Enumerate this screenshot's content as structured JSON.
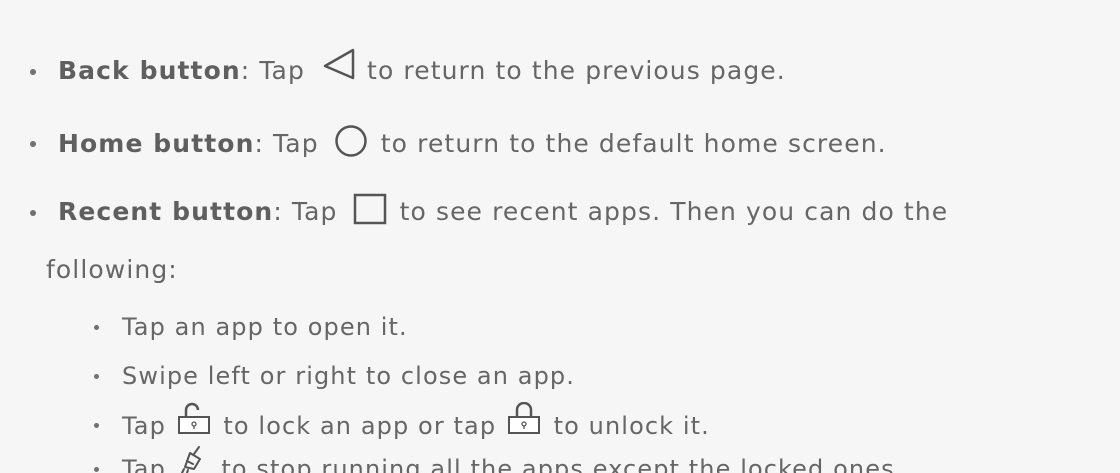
{
  "items": [
    {
      "term": "Back button",
      "colon": ":",
      "before": " Tap ",
      "icon": "back-triangle-icon",
      "after": " to return to the previous page."
    },
    {
      "term": "Home button",
      "colon": ":",
      "before": " Tap ",
      "icon": "home-circle-icon",
      "after": " to return to the default home screen."
    },
    {
      "term": "Recent button",
      "colon": ":",
      "before": " Tap ",
      "icon": "recent-square-icon",
      "after": " to see recent apps. Then you can do the",
      "continuation": "following:"
    }
  ],
  "subitems": [
    {
      "text": "Tap an app to open it."
    },
    {
      "text": "Swipe left or right to close an app."
    },
    {
      "before": "Tap ",
      "icon1": "unlocked-padlock-icon",
      "middle": " to lock an app or tap ",
      "icon2": "locked-padlock-icon",
      "after": " to unlock it."
    },
    {
      "before": "Tap ",
      "icon": "broom-clear-icon",
      "after": " to stop running all the apps except the locked ones."
    }
  ],
  "colors": {
    "background": "#f6f6f6",
    "text": "#666666",
    "icon_stroke": "#555555"
  }
}
